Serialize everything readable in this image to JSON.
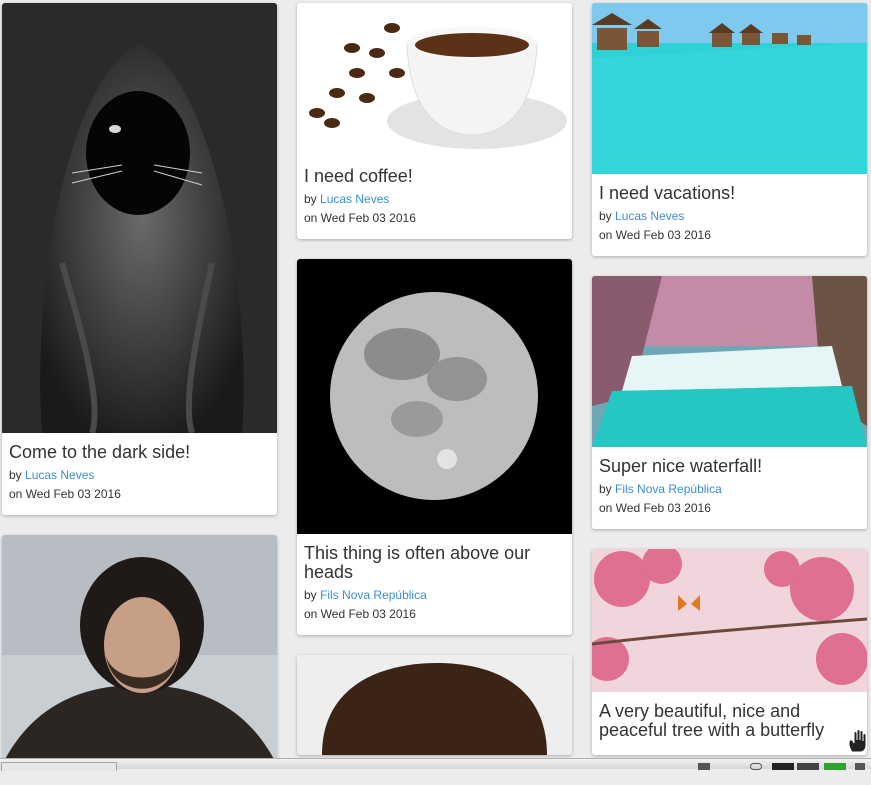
{
  "columns": [
    {
      "cards": [
        {
          "title": "Come to the dark side!",
          "by_label": "by",
          "author": "Lucas Neves",
          "date": "on Wed Feb 03 2016",
          "image_icon": "hooded-cat-image"
        },
        {
          "title": "",
          "by_label": "",
          "author": "",
          "date": "",
          "image_icon": "bearded-man-fur-cloak-image"
        }
      ]
    },
    {
      "cards": [
        {
          "title": "I need coffee!",
          "by_label": "by",
          "author": "Lucas Neves",
          "date": "on Wed Feb 03 2016",
          "image_icon": "coffee-cup-image"
        },
        {
          "title": "This thing is often above our heads",
          "by_label": "by",
          "author": "Fils Nova República",
          "date": "on Wed Feb 03 2016",
          "image_icon": "full-moon-image"
        },
        {
          "title": "",
          "by_label": "",
          "author": "",
          "date": "",
          "image_icon": "bald-man-image"
        }
      ]
    },
    {
      "cards": [
        {
          "title": "I need vacations!",
          "by_label": "by",
          "author": "Lucas Neves",
          "date": "on Wed Feb 03 2016",
          "image_icon": "overwater-bungalows-image"
        },
        {
          "title": "Super nice waterfall!",
          "by_label": "by",
          "author": "Fils Nova República",
          "date": "on Wed Feb 03 2016",
          "image_icon": "waterfall-image"
        },
        {
          "title": "A very beautiful, nice and peaceful tree with a butterfly",
          "by_label": "",
          "author": "",
          "date": "",
          "image_icon": "pink-tree-butterfly-image"
        }
      ]
    }
  ],
  "colors": {
    "link": "#3b8ed4",
    "text": "#333333",
    "background": "#ececec"
  }
}
